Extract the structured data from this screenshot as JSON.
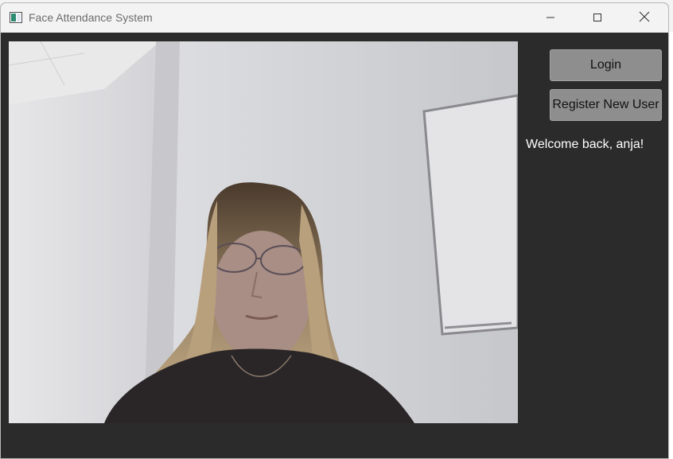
{
  "window": {
    "title": "Face Attendance System"
  },
  "actions": {
    "login_label": "Login",
    "register_label": "Register New User"
  },
  "status": {
    "message": "Welcome back, anja!"
  },
  "colors": {
    "window_bg": "#2b2b2b",
    "button_bg": "#8e8e8e",
    "titlebar_bg": "#f3f3f3"
  },
  "icons": {
    "app": "app-window-icon",
    "minimize": "minimize-icon",
    "maximize": "maximize-icon",
    "close": "close-icon"
  }
}
